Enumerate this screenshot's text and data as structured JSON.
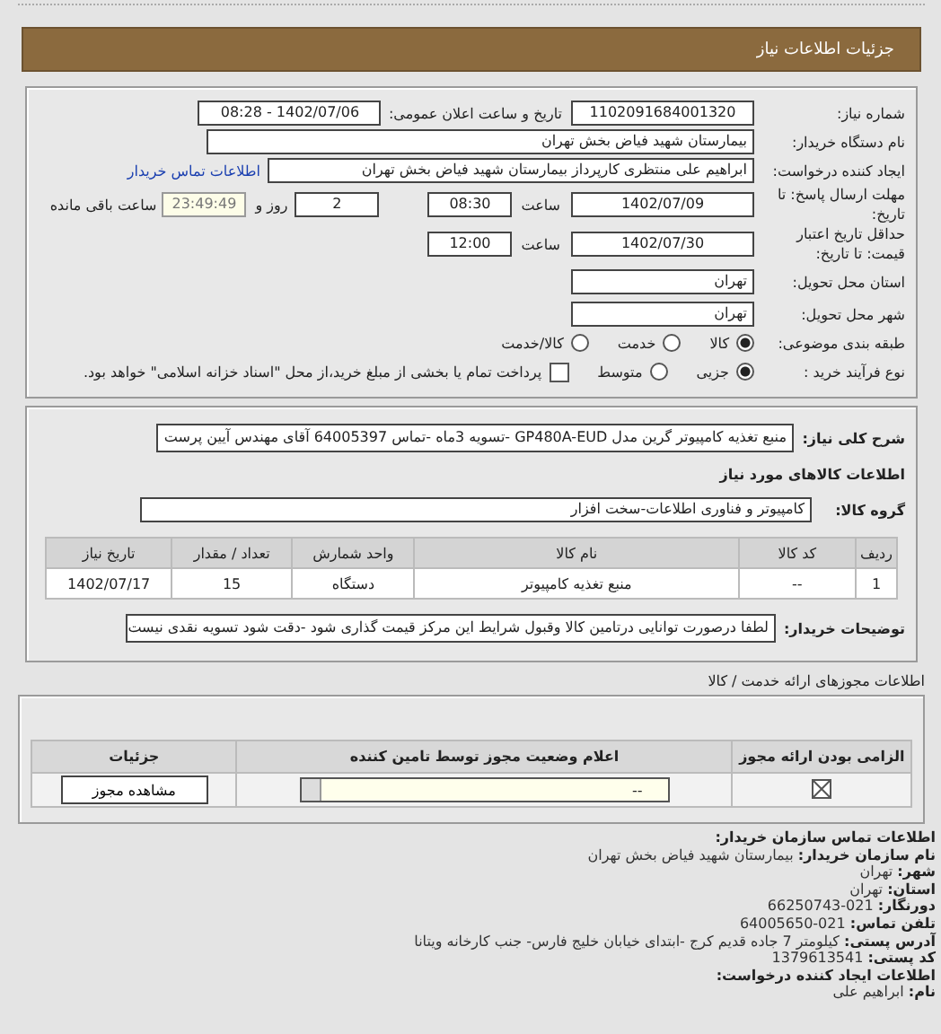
{
  "header": {
    "title": "جزئیات اطلاعات نیاز"
  },
  "summary": {
    "need_number": {
      "label": "شماره نیاز:",
      "value": "1102091684001320"
    },
    "announce": {
      "label": "تاریخ و ساعت اعلان عمومی:",
      "value": "1402/07/06 - 08:28"
    },
    "buyer": {
      "label": "نام دستگاه خریدار:",
      "value": "بیمارستان شهید فیاض بخش تهران"
    },
    "requester": {
      "label": "ایجاد کننده درخواست:",
      "value": "ابراهیم علی منتظری کارپرداز بیمارستان شهید فیاض بخش تهران",
      "link": "اطلاعات تماس خریدار"
    },
    "deadline": {
      "label": "مهلت ارسال پاسخ: تا تاریخ:",
      "date": "1402/07/09",
      "time_label": "ساعت",
      "time": "08:30",
      "days": "2",
      "days_label": "روز و",
      "remaining": "23:49:49",
      "remaining_label": "ساعت باقی مانده"
    },
    "validity": {
      "label": "حداقل تاریخ اعتبار قیمت: تا تاریخ:",
      "date": "1402/07/30",
      "time_label": "ساعت",
      "time": "12:00"
    },
    "province": {
      "label": "استان محل تحویل:",
      "value": "تهران"
    },
    "city": {
      "label": "شهر محل تحویل:",
      "value": "تهران"
    },
    "category": {
      "label": "طبقه بندی موضوعی:",
      "options": [
        {
          "label": "کالا",
          "selected": true
        },
        {
          "label": "خدمت",
          "selected": false
        },
        {
          "label": "کالا/خدمت",
          "selected": false
        }
      ]
    },
    "process": {
      "label": "نوع فرآیند خرید :",
      "options": [
        {
          "label": "جزیی",
          "selected": true
        },
        {
          "label": "متوسط",
          "selected": false
        }
      ],
      "treasury": {
        "label": "پرداخت تمام یا بخشی از مبلغ خرید،از محل \"اسناد خزانه اسلامی\" خواهد بود.",
        "checked": false
      }
    }
  },
  "details": {
    "description": {
      "label": "شرح کلی نیاز:",
      "value": "منبع تغذیه کامپیوتر گرین مدل GP480A-EUD -تسویه 3ماه -تماس 64005397 آقای مهندس آیین پرست"
    },
    "goods_title": "اطلاعات کالاهای مورد نیاز",
    "group": {
      "label": "گروه کالا:",
      "value": "کامپیوتر و فناوری اطلاعات-سخت افزار"
    },
    "table": {
      "columns": [
        "ردیف",
        "کد کالا",
        "نام کالا",
        "واحد شمارش",
        "تعداد / مقدار",
        "تاریخ نیاز"
      ],
      "rows": [
        [
          "1",
          "--",
          "منبع تغذیه کامپیوتر",
          "دستگاه",
          "15",
          "1402/07/17"
        ]
      ]
    },
    "notes": {
      "label": "توضیحات خریدار:",
      "value": "لطفا درصورت توانایی درتامین کالا وقبول شرایط این مرکز قیمت گذاری شود -دقت شود تسویه نقدی نیست"
    }
  },
  "permits": {
    "title": "اطلاعات مجوزهای ارائه خدمت / کالا",
    "columns": [
      "الزامی بودن ارائه مجوز",
      "اعلام وضعیت مجوز توسط تامین کننده",
      "جزئیات"
    ],
    "rows": [
      {
        "required": true,
        "status": "--",
        "button": "مشاهده مجوز"
      }
    ]
  },
  "contact": {
    "title": "اطلاعات تماس سازمان خریدار:",
    "lines": [
      {
        "label": "نام سازمان خریدار:",
        "value": "بیمارستان شهید فیاض بخش تهران"
      },
      {
        "label": "شهر:",
        "value": "تهران"
      },
      {
        "label": "استان:",
        "value": "تهران"
      },
      {
        "label": "دورنگار:",
        "value": "021-66250743"
      },
      {
        "label": "تلفن تماس:",
        "value": "021-64005650"
      },
      {
        "label": "آدرس پستی:",
        "value": "کیلومتر 7 جاده قدیم کرج -ابتدای خیابان خلیج فارس- جنب کارخانه ویتانا"
      },
      {
        "label": "کد پستی:",
        "value": "1379613541"
      }
    ],
    "requester_title": "اطلاعات ایجاد کننده درخواست:",
    "requester_lines": [
      {
        "label": "نام:",
        "value": "ابراهیم علی"
      }
    ]
  }
}
